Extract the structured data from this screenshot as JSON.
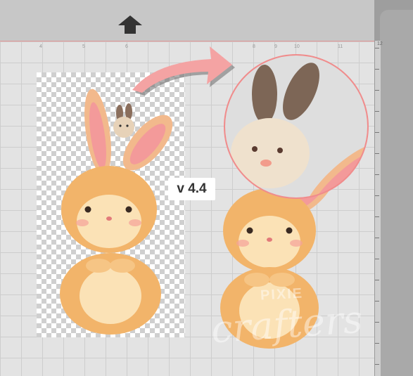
{
  "canvas": {
    "version_label": "v 4.4",
    "ruler_numbers": [
      "12"
    ],
    "top_ruler_numbers": [
      "4",
      "5",
      "6",
      "8",
      "9",
      "10",
      "11"
    ],
    "colors": {
      "mat_border": "#e49595",
      "arrow": "#f4a3a3",
      "magnifier_ring": "#f08c8c"
    }
  },
  "toolbar": {
    "up_icon": "up-arrow-icon"
  },
  "watermark": {
    "line1": "PIXIE",
    "line2": "crafters"
  }
}
